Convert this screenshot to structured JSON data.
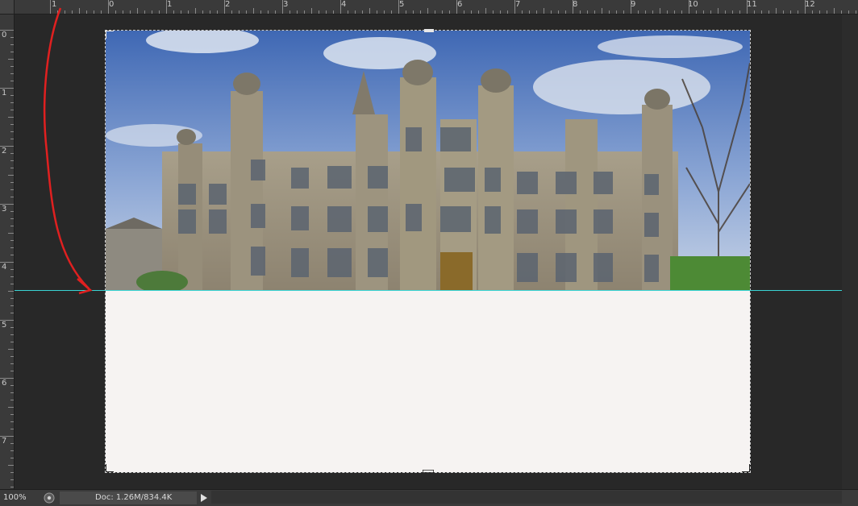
{
  "ruler": {
    "horizontal_labels": [
      "1",
      "0",
      "1",
      "2",
      "3",
      "4",
      "5",
      "6",
      "7",
      "8",
      "9",
      "10",
      "11",
      "12"
    ],
    "vertical_labels": [
      "0",
      "1",
      "2",
      "3",
      "4",
      "5",
      "6",
      "7"
    ]
  },
  "status": {
    "zoom": "100%",
    "doc_info": "Doc: 1.26M/834.4K"
  },
  "colors": {
    "guide": "#39d4d4",
    "annotation_arrow": "#e02020",
    "canvas_fill": "#f6f3f2"
  },
  "icons": {
    "status_menu": "status-menu-icon",
    "expand": "play-arrow-icon"
  }
}
